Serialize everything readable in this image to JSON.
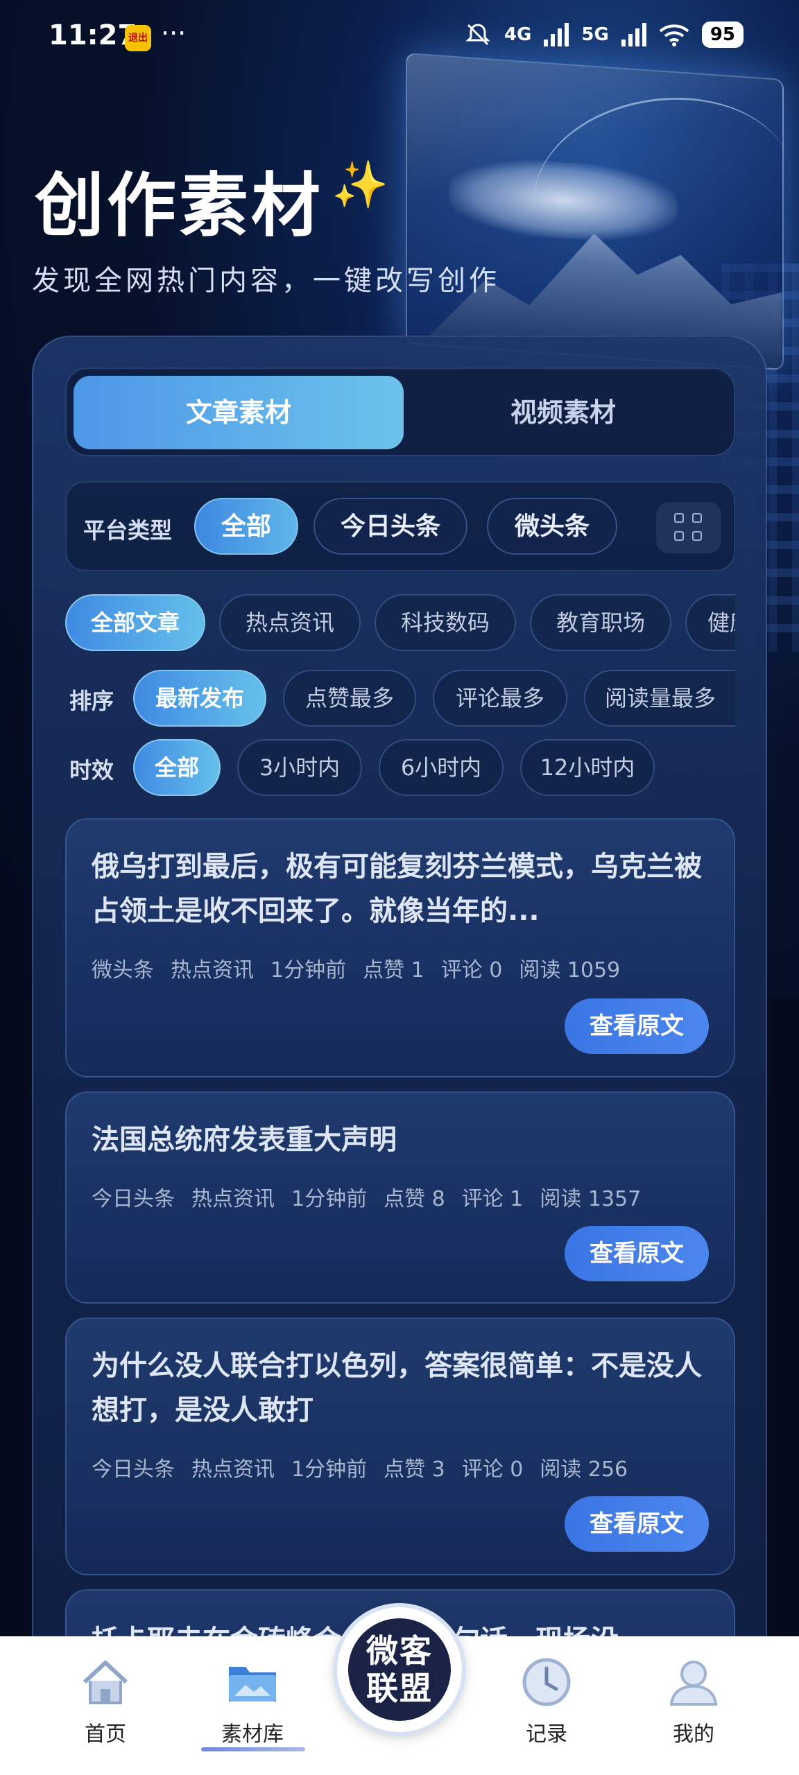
{
  "status_bar": {
    "time": "11:27",
    "app_badge": "退出",
    "more": "···",
    "signal_4g": "4G",
    "signal_5g": "5G",
    "battery": "95"
  },
  "header": {
    "title": "创作素材",
    "sparkle": "✨",
    "subtitle": "发现全网热门内容，一键改写创作"
  },
  "tabs": [
    {
      "label": "文章素材",
      "active": true
    },
    {
      "label": "视频素材",
      "active": false
    }
  ],
  "platform": {
    "label": "平台类型",
    "options": [
      "全部",
      "今日头条",
      "微头条"
    ],
    "selected": "全部"
  },
  "categories": {
    "options": [
      "全部文章",
      "热点资讯",
      "科技数码",
      "教育职场",
      "健康"
    ],
    "selected": "全部文章"
  },
  "sort": {
    "label": "排序",
    "options": [
      "最新发布",
      "点赞最多",
      "评论最多",
      "阅读量最多"
    ],
    "selected": "最新发布"
  },
  "timeframe": {
    "label": "时效",
    "options": [
      "全部",
      "3小时内",
      "6小时内",
      "12小时内"
    ],
    "selected": "全部"
  },
  "articles": [
    {
      "title": "俄乌打到最后，极有可能复刻芬兰模式，乌克兰被占领土是收不回来了。就像当年的...",
      "platform": "微头条",
      "category": "热点资讯",
      "time": "1分钟前",
      "likes": "点赞 1",
      "comments": "评论 0",
      "reads": "阅读 1059",
      "button": "查看原文"
    },
    {
      "title": "法国总统府发表重大声明",
      "platform": "今日头条",
      "category": "热点资讯",
      "time": "1分钟前",
      "likes": "点赞 8",
      "comments": "评论 1",
      "reads": "阅读 1357",
      "button": "查看原文"
    },
    {
      "title": "为什么没人联合打以色列，答案很简单：不是没人想打，是没人敢打",
      "platform": "今日头条",
      "category": "热点资讯",
      "time": "1分钟前",
      "likes": "点赞 3",
      "comments": "评论 0",
      "reads": "阅读 256",
      "button": "查看原文"
    },
    {
      "title": "托卡耶夫在金砖峰会上说出一句话，现场没...",
      "partial": true
    }
  ],
  "bottom_nav": {
    "items": [
      {
        "label": "首页",
        "icon": "home-icon"
      },
      {
        "label": "素材库",
        "icon": "folder-icon",
        "active": true
      },
      {
        "label": "记录",
        "icon": "clock-icon"
      },
      {
        "label": "我的",
        "icon": "user-icon"
      }
    ],
    "center": {
      "line1": "微客",
      "line2": "联盟"
    }
  },
  "colors": {
    "accent": "#4d97e8",
    "button": "#3a76e4",
    "sparkle": "#f5cf54"
  }
}
